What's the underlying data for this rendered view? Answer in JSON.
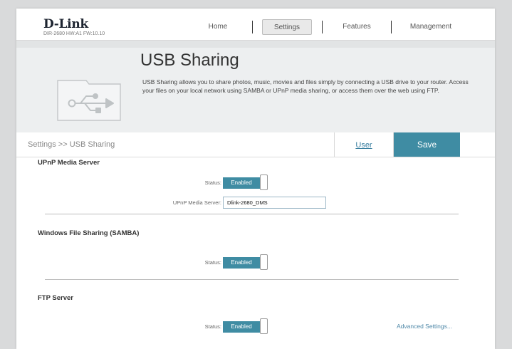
{
  "brand": {
    "logo": "D-Link",
    "subtitle": "DIR-2680 HW:A1 FW:10.10"
  },
  "nav": {
    "home": "Home",
    "settings": "Settings",
    "features": "Features",
    "management": "Management"
  },
  "hero": {
    "title": "USB Sharing",
    "description": "USB Sharing allows you to share photos, music, movies and files simply by connecting a USB drive to your router. Access your files on your local network using SAMBA or UPnP media sharing, or access them over the web using FTP."
  },
  "breadcrumb": "Settings >> USB Sharing",
  "actions": {
    "user_label": "User",
    "save_label": "Save"
  },
  "upnp": {
    "title": "UPnP Media Server",
    "status_label": "Status:",
    "status_value": "Enabled",
    "server_label": "UPnP Media Server:",
    "server_value": "Dlink-2680_DMS"
  },
  "samba": {
    "title": "Windows File Sharing (SAMBA)",
    "status_label": "Status:",
    "status_value": "Enabled"
  },
  "ftp": {
    "title": "FTP Server",
    "status_label": "Status:",
    "status_value": "Enabled",
    "advanced_label": "Advanced Settings..."
  },
  "colors": {
    "accent": "#3f8ca3",
    "hero_bg": "#edeff0",
    "page_bg": "#d9dadb"
  },
  "icons": {
    "hero": "usb-icon"
  }
}
